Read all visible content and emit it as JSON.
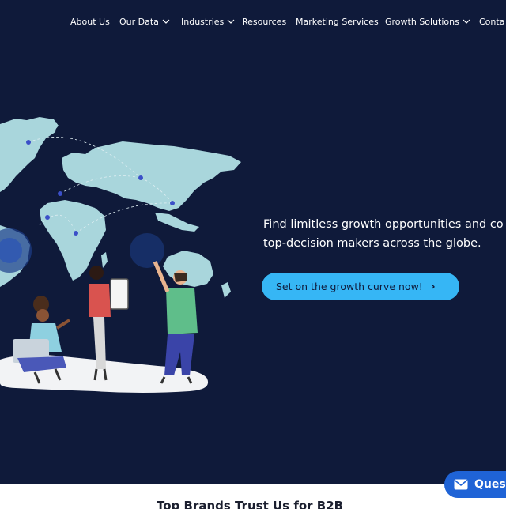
{
  "nav": {
    "items": [
      {
        "label": "About Us",
        "has_dropdown": false
      },
      {
        "label": "Our Data",
        "has_dropdown": true
      },
      {
        "label": "Industries",
        "has_dropdown": true
      },
      {
        "label": "Resources",
        "has_dropdown": false
      },
      {
        "label": "Marketing Services",
        "has_dropdown": false
      },
      {
        "label": "Growth Solutions",
        "has_dropdown": true
      },
      {
        "label": "Conta",
        "has_dropdown": false
      }
    ]
  },
  "hero": {
    "tagline_line1": "Find limitless growth opportunities and co",
    "tagline_line2": "top-decision makers across the globe.",
    "cta_label": "Set on the growth curve now!",
    "cta_icon": "chevron-right-icon",
    "illustration_icons": [
      "world-map-illustration",
      "team-pointing-illustration"
    ]
  },
  "chat": {
    "label": "Ques",
    "icon": "mail-icon"
  },
  "next_section": {
    "title_partial": "Top Brands Trust Us for B2B"
  },
  "colors": {
    "hero_bg": "#0f1a3a",
    "cta_bg": "#36b6f5",
    "chat_bg": "#1f63d6",
    "map_fill": "#a9d6dc"
  }
}
